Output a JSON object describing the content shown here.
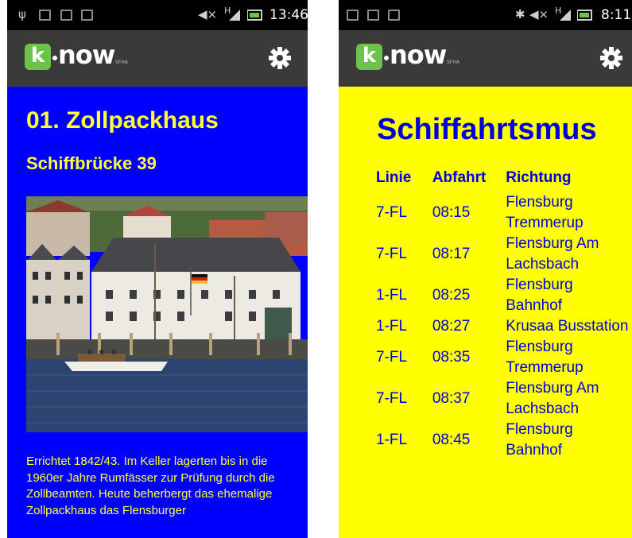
{
  "left_screen": {
    "status_bar": {
      "time": "13:46",
      "network": "H"
    },
    "app_bar": {
      "logo_letter": "k",
      "logo_word": "now",
      "logo_sub": "SFHA",
      "settings_icon": "gear-icon"
    },
    "title": "01. Zollpackhaus",
    "subtitle": "Schiffbrücke 39",
    "description": "Errichtet 1842/43. Im Keller lagerten bis in die 1960er Jahre Rumfässer zur Prüfung durch die Zollbeamten. Heute beherbergt das ehemalige Zollpackhaus das Flensburger",
    "colors": {
      "background": "#0000ff",
      "text": "#ffff33"
    }
  },
  "right_screen": {
    "status_bar": {
      "time": "8:11",
      "network": "H"
    },
    "app_bar": {
      "logo_letter": "k",
      "logo_word": "now",
      "logo_sub": "SFHA",
      "settings_icon": "gear-icon"
    },
    "title": "Schiffahrtsmus",
    "table": {
      "headers": [
        "Linie",
        "Abfahrt",
        "Richtung"
      ],
      "rows": [
        {
          "line": "7-FL",
          "time": "08:15",
          "direction": "Flensburg Tremmerup"
        },
        {
          "line": "7-FL",
          "time": "08:17",
          "direction": "Flensburg Am Lachsbach"
        },
        {
          "line": "1-FL",
          "time": "08:25",
          "direction": "Flensburg Bahnhof"
        },
        {
          "line": "1-FL",
          "time": "08:27",
          "direction": "Krusaa Busstation"
        },
        {
          "line": "7-FL",
          "time": "08:35",
          "direction": "Flensburg Tremmerup"
        },
        {
          "line": "7-FL",
          "time": "08:37",
          "direction": "Flensburg Am Lachsbach"
        },
        {
          "line": "1-FL",
          "time": "08:45",
          "direction": "Flensburg Bahnhof"
        }
      ]
    },
    "colors": {
      "background": "#ffff00",
      "text": "#0000dd"
    }
  }
}
